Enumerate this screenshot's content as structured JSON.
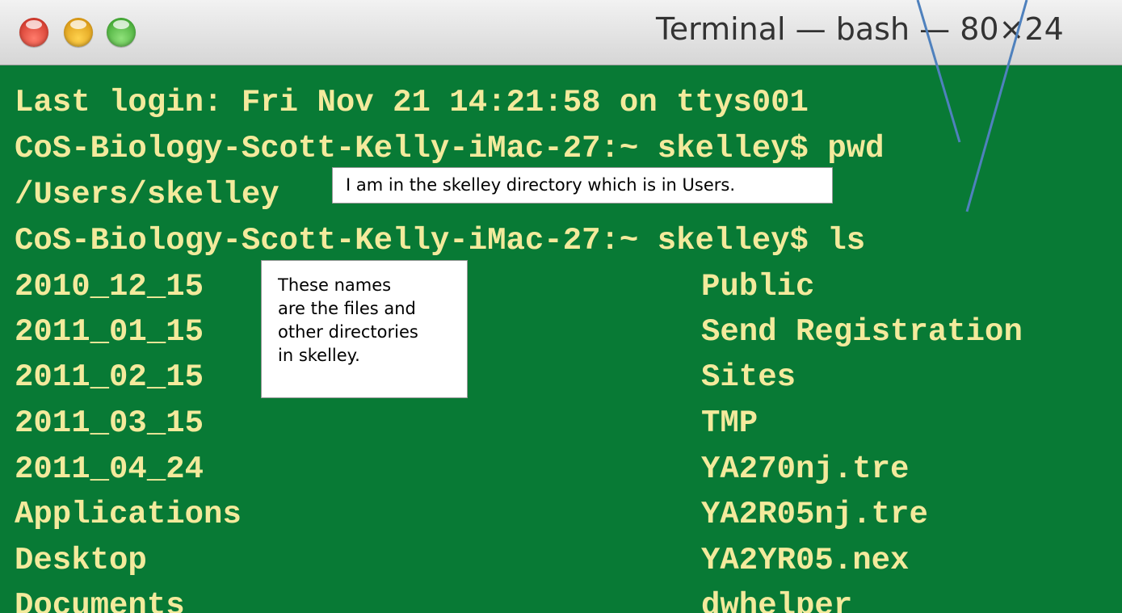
{
  "window": {
    "title": "Terminal — bash — 80×24",
    "colors": {
      "terminal_background": "#087a35",
      "terminal_text": "#f3ea9c",
      "close": "#e0443e",
      "minimize": "#f5b932",
      "zoom": "#5ccd44"
    }
  },
  "terminal": {
    "last_login": "Last login: Fri Nov 21 14:21:58 on ttys001",
    "prompt_pwd": "CoS-Biology-Scott-Kelly-iMac-27:~ skelley$ pwd",
    "pwd_output": "/Users/skelley",
    "prompt_ls": "CoS-Biology-Scott-Kelly-iMac-27:~ skelley$ ls",
    "listing_left": [
      "2010_12_15",
      "2011_01_15",
      "2011_02_15",
      "2011_03_15",
      "2011_04_24",
      "Applications",
      "Desktop",
      "Documents"
    ],
    "listing_right": [
      "Public",
      "Send Registration",
      "Sites",
      "TMP",
      "YA270nj.tre",
      "YA2R05nj.tre",
      "YA2YR05.nex",
      "dwhelper"
    ]
  },
  "annotations": {
    "pwd_note": "I am in the skelley directory which is in Users.",
    "ls_note_lines": [
      "These names",
      "are the files and",
      "other directories",
      "in skelley."
    ],
    "arrow_color": "#4f81bd"
  }
}
